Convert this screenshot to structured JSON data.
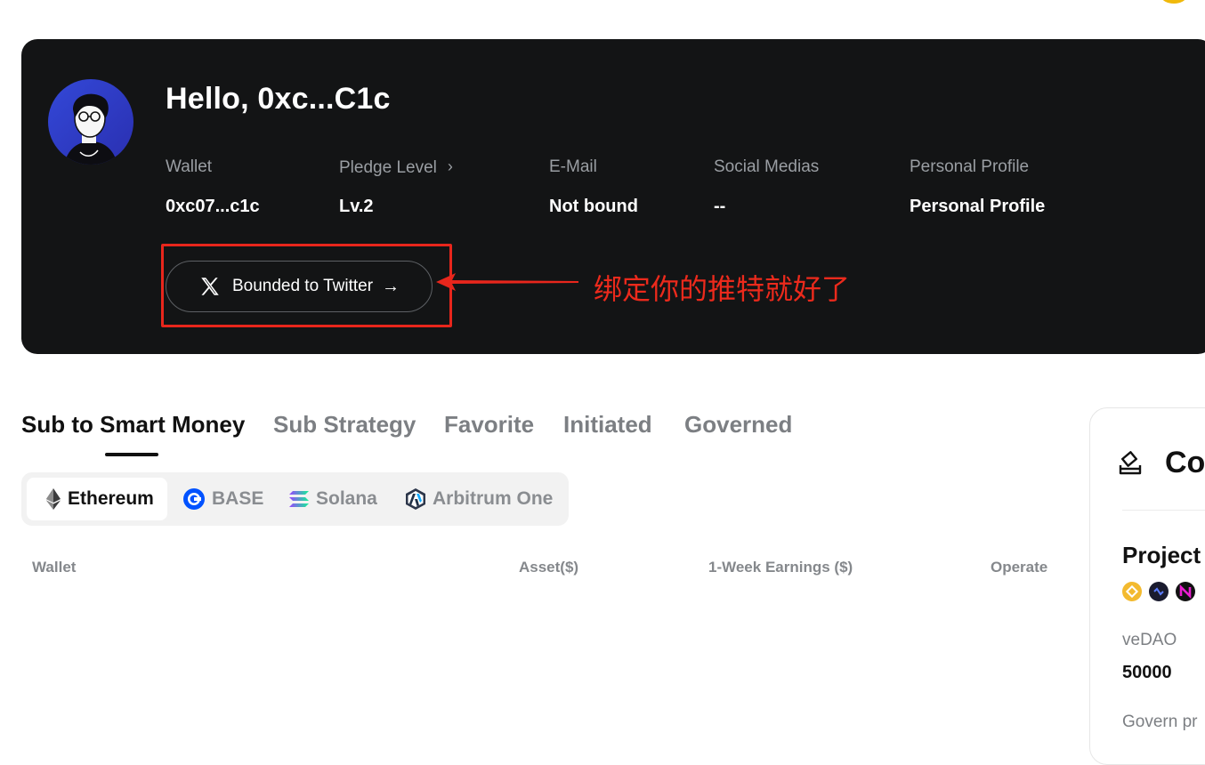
{
  "profile": {
    "greeting": "Hello, 0xc...C1c",
    "fields": [
      {
        "label": "Wallet",
        "value": "0xc07...c1c"
      },
      {
        "label": "Pledge Level",
        "value": "Lv.2"
      },
      {
        "label": "E-Mail",
        "value": "Not bound"
      },
      {
        "label": "Social Medias",
        "value": "--"
      },
      {
        "label": "Personal Profile",
        "value": "Personal Profile"
      }
    ],
    "twitter_button": "Bounded to Twitter",
    "annotation": "绑定你的推特就好了"
  },
  "tabs": [
    {
      "label": "Sub to Smart Money",
      "active": true
    },
    {
      "label": "Sub Strategy",
      "active": false
    },
    {
      "label": "Favorite",
      "active": false
    },
    {
      "label": "Initiated",
      "active": false
    },
    {
      "label": "Governed",
      "active": false
    }
  ],
  "chains": [
    {
      "label": "Ethereum",
      "active": true,
      "icon": "ethereum-icon"
    },
    {
      "label": "BASE",
      "active": false,
      "icon": "base-icon"
    },
    {
      "label": "Solana",
      "active": false,
      "icon": "solana-icon"
    },
    {
      "label": "Arbitrum One",
      "active": false,
      "icon": "arbitrum-icon"
    }
  ],
  "table": {
    "columns": [
      "Wallet",
      "Asset($)",
      "1-Week Earnings ($)",
      "Operate"
    ]
  },
  "side_panel": {
    "title": "Co",
    "section": "Project",
    "dao_label": "veDAO",
    "dao_value": "50000",
    "govern_label": "Govern pr"
  },
  "colors": {
    "card_bg": "#131415",
    "annotation_red": "#ec2a1c",
    "base_blue": "#0052ff",
    "coin_yellow": "#f0b90b"
  }
}
